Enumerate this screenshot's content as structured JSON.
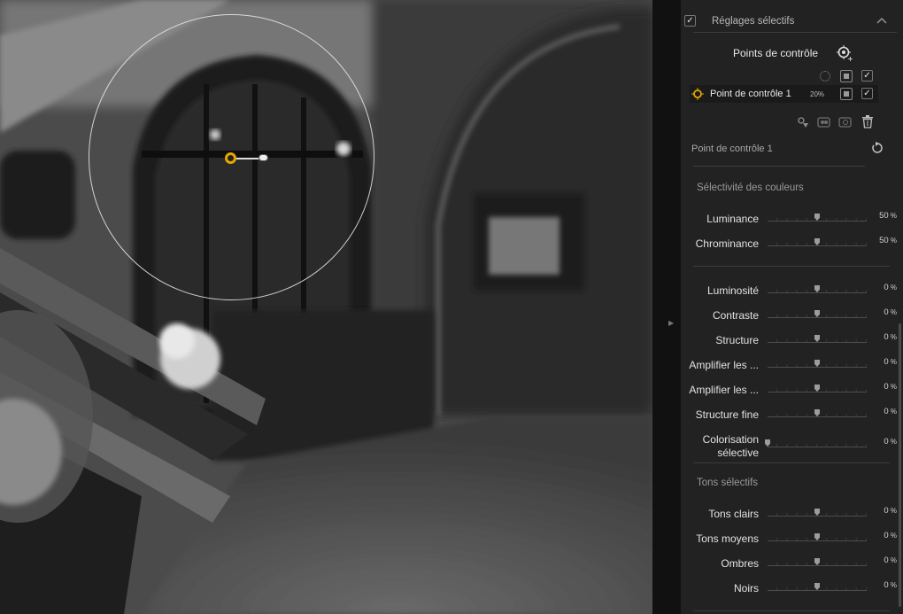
{
  "header": {
    "section_title": "Réglages sélectifs",
    "checked": true,
    "collapse_icon": "chevron-up-icon"
  },
  "control_points": {
    "title": "Points de contrôle",
    "add_icon": "add-control-point-icon",
    "items": [
      {
        "name": "Point de contrôle 1",
        "opacity": "20%",
        "enabled": true
      }
    ],
    "toolbar_icons": [
      "duplicate-point-icon",
      "group-points-icon",
      "ungroup-points-icon",
      "delete-icon"
    ]
  },
  "point_detail": {
    "title": "Point de contrôle 1",
    "reset_icon": "reset-icon"
  },
  "color_selectivity": {
    "title": "Sélectivité des couleurs",
    "sliders": [
      {
        "label": "Luminance",
        "value": "50",
        "level": 0.5
      },
      {
        "label": "Chrominance",
        "value": "50",
        "level": 0.5
      }
    ]
  },
  "adjustments": {
    "sliders": [
      {
        "label": "Luminosité",
        "value": "0",
        "level": 0.5
      },
      {
        "label": "Contraste",
        "value": "0",
        "level": 0.5
      },
      {
        "label": "Structure",
        "value": "0",
        "level": 0.5
      },
      {
        "label": "Amplifier les ...",
        "value": "0",
        "level": 0.5
      },
      {
        "label": "Amplifier les ...",
        "value": "0",
        "level": 0.5
      },
      {
        "label": "Structure fine",
        "value": "0",
        "level": 0.5
      },
      {
        "label": "Colorisation sélective",
        "value": "0",
        "level": 0.0
      }
    ]
  },
  "selective_tones": {
    "title": "Tons sélectifs",
    "sliders": [
      {
        "label": "Tons clairs",
        "value": "0",
        "level": 0.5
      },
      {
        "label": "Tons moyens",
        "value": "0",
        "level": 0.5
      },
      {
        "label": "Ombres",
        "value": "0",
        "level": 0.5
      },
      {
        "label": "Noirs",
        "value": "0",
        "level": 0.5
      }
    ]
  },
  "unit": "%",
  "colors": {
    "accent": "#e6a700",
    "panel_bg": "#222222",
    "text": "#e2e2e2"
  }
}
